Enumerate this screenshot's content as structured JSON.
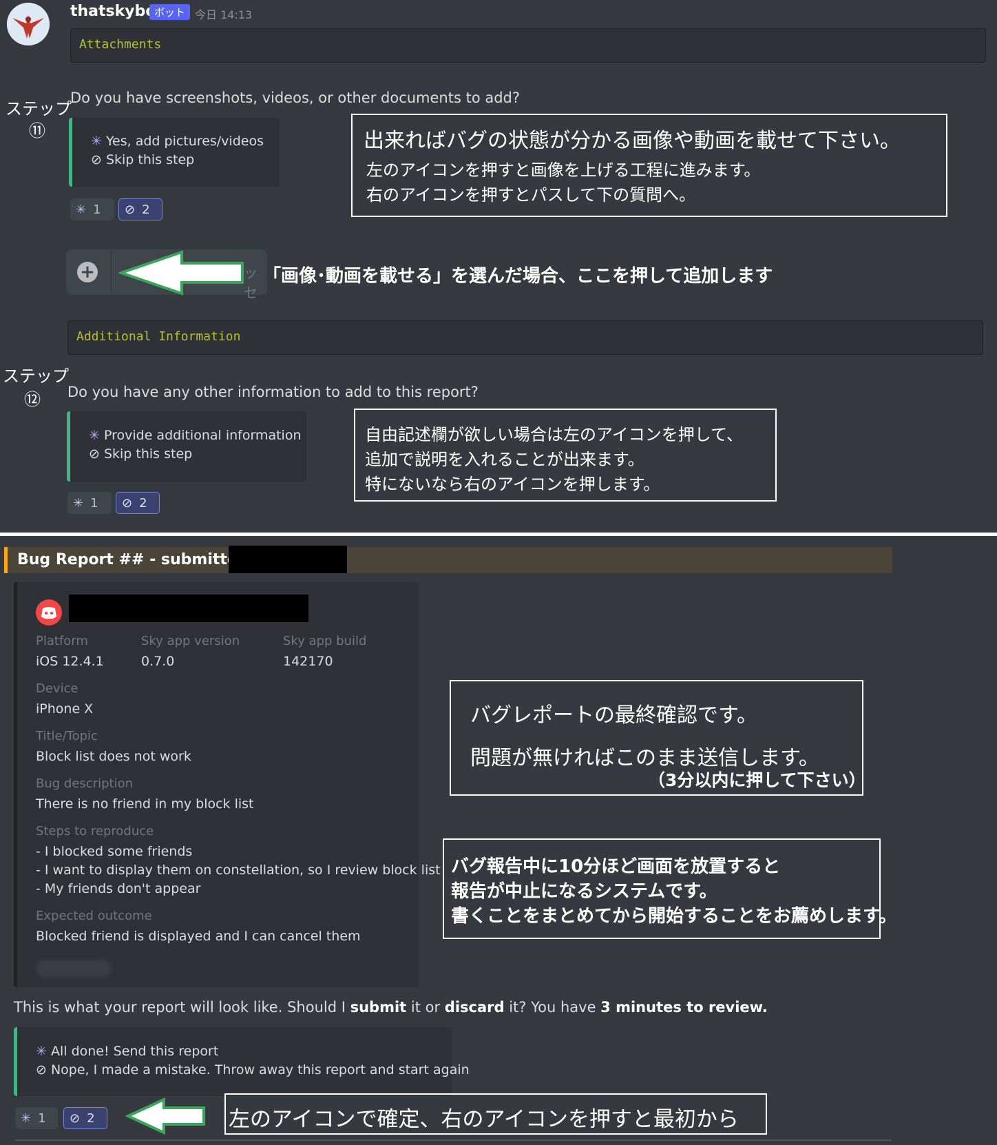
{
  "message": {
    "username": "thatskybot",
    "bot_badge": "ボット",
    "timestamp": "今日 14:13"
  },
  "section_attachments": {
    "header": "Attachments",
    "step_label": "ステップ",
    "step_number": "⑪",
    "question": "Do you have screenshots, videos, or other documents to add?",
    "options": [
      "Yes, add pictures/videos",
      "Skip this step"
    ],
    "reactions": [
      {
        "icon": "sparkle-icon",
        "count": "1"
      },
      {
        "icon": "prohibited-icon",
        "count": "2"
      }
    ]
  },
  "note_attachments": {
    "title": "出来ればバグの状態が分かる画像や動画を載せて下さい。",
    "line1": "左のアイコンを押すと画像を上げる工程に進みます。",
    "line2": "右のアイコンを押すとパスして下の質問へ。"
  },
  "upload_bar": {
    "placeholder_fragment": "ッセ",
    "annotation": "「画像･動画を載せる」を選んだ場合、ここを押して追加します"
  },
  "section_additional": {
    "header": "Additional Information",
    "step_label": "ステップ",
    "step_number": "⑫",
    "question": "Do you have any other information to add to this report?",
    "options": [
      "Provide additional information",
      "Skip this step"
    ],
    "reactions": [
      {
        "icon": "sparkle-icon",
        "count": "1"
      },
      {
        "icon": "prohibited-icon",
        "count": "2"
      }
    ]
  },
  "note_additional": {
    "line1": "自由記述欄が欲しい場合は左のアイコンを押して、",
    "line2": "追加で説明を入れることが出来ます。",
    "line3": "特にないなら右のアイコンを押します。"
  },
  "report": {
    "title": "Bug Report ## - submitted by",
    "fields": {
      "platform_label": "Platform",
      "platform_value": "iOS 12.4.1",
      "version_label": "Sky app version",
      "version_value": "0.7.0",
      "build_label": "Sky app build",
      "build_value": "142170",
      "device_label": "Device",
      "device_value": "iPhone X",
      "title_label": "Title/Topic",
      "title_value": "Block list does not work",
      "desc_label": "Bug description",
      "desc_value": "There is no friend in my block list",
      "steps_label": "Steps to reproduce",
      "steps": [
        "- I blocked some friends",
        "- I want to display them on constellation, so I review block list",
        "- My friends don't appear"
      ],
      "outcome_label": "Expected outcome",
      "outcome_value": "Blocked friend is displayed and I can cancel them"
    }
  },
  "note_confirm": {
    "line1": "バグレポートの最終確認です。",
    "line2": "問題が無ければこのまま送信します。",
    "line3": "（3分以内に押して下さい）"
  },
  "note_timeout": {
    "line1": "バグ報告中に10分ほど画面を放置すると",
    "line2": "報告が中止になるシステムです。",
    "line3": "書くことをまとめてから開始することをお薦めします。"
  },
  "review_prompt": {
    "part1": "This is what your report will look like. Should I ",
    "submit": "submit",
    "part2": " it or ",
    "discard": "discard",
    "part3": " it? You have ",
    "time": "3 minutes to review."
  },
  "final_embed": {
    "options": [
      "All done! Send this report",
      "Nope, I made a mistake. Throw away this report and start again"
    ],
    "reactions": [
      {
        "icon": "sparkle-icon",
        "count": "1"
      },
      {
        "icon": "prohibited-icon",
        "count": "2"
      }
    ]
  },
  "note_final": {
    "text": "左のアイコンで確定、右のアイコンを押すと最初から"
  },
  "colors": {
    "background": "#36393f",
    "embed_bg": "#2f3136",
    "embed_accent_green": "#43b581",
    "embed_accent_orange": "#faa61a",
    "code_text": "#b5c12a",
    "bot_badge": "#5865f2",
    "arrow_outline": "#3ba55c"
  }
}
